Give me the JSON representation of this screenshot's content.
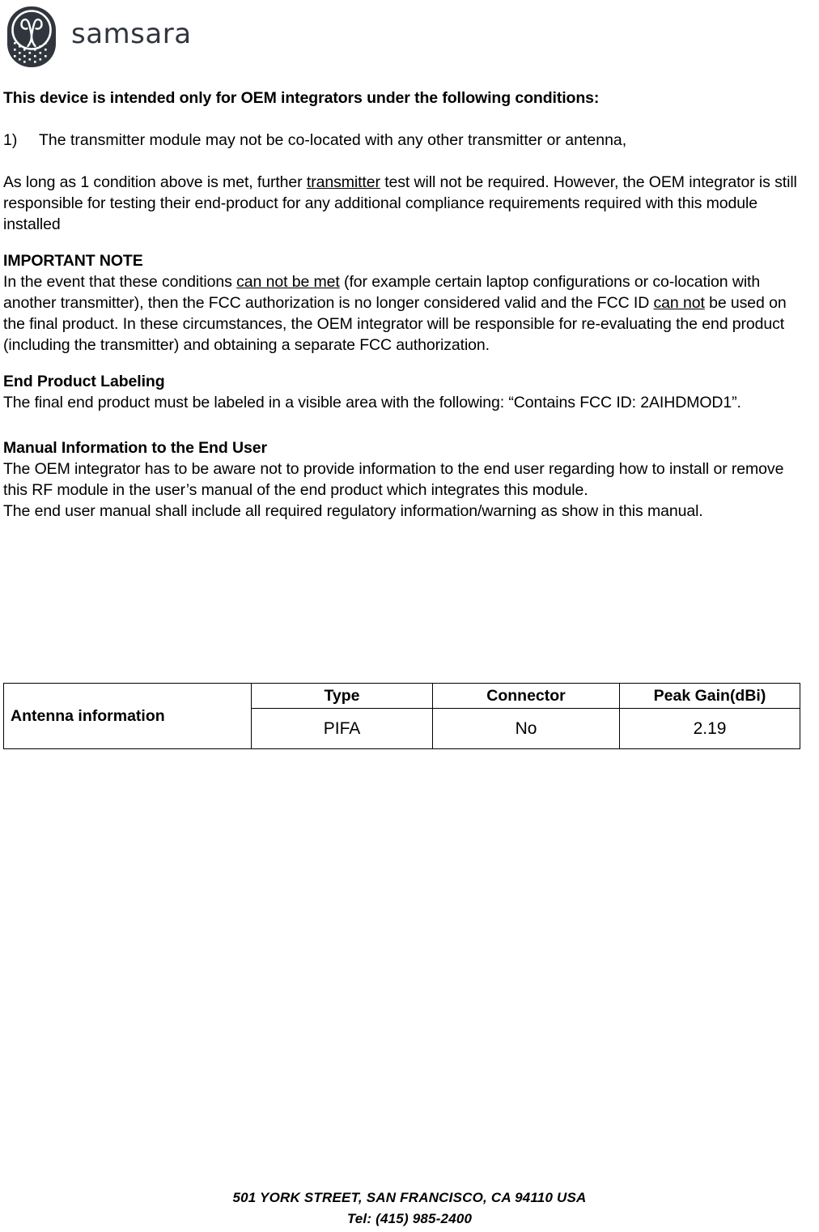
{
  "brand": {
    "logo_icon": "samsara-owl-logo-icon",
    "wordmark": "samsara",
    "logo_color": "#31363e"
  },
  "document": {
    "heading": "This device is intended only for OEM integrators under the following conditions:",
    "condition": {
      "number": "1)",
      "text": "The transmitter module may not be co-located with any other transmitter or antenna,"
    },
    "paragraph_1": {
      "lead": "As long as 1 condition above is met, further ",
      "underlined": "transmitter",
      "rest": " test will not be required. However, the OEM integrator is still responsible for testing their end-product for any additional compliance requirements required with this module installed"
    },
    "important_note": {
      "title": "IMPORTANT NOTE",
      "part_1": "In the event that these conditions ",
      "underlined_1": "can not be met",
      "part_2": " (for example certain laptop configurations or co-location with another transmitter), then the FCC authorization is no longer considered valid and the FCC ID ",
      "underlined_2": "can not",
      "part_3": " be used on the final product. In these circumstances, the OEM integrator will be responsible for re-evaluating the end product (including the transmitter) and obtaining a separate FCC authorization."
    },
    "end_product_labeling": {
      "title": "End Product Labeling",
      "body": "The final end product must be labeled in a visible area with the following: “Contains FCC ID: 2AIHDMOD1”."
    },
    "manual_information": {
      "title": "Manual Information to the End User",
      "body_1": "The OEM integrator has to be aware not to provide information to the end user regarding how to install or remove this RF module in the user’s manual of the end product which integrates this module.",
      "body_2": "The end user manual shall include all required regulatory information/warning as show in this manual."
    }
  },
  "antenna_table": {
    "row_label": "Antenna information",
    "headers": [
      "Type",
      "Connector",
      "Peak Gain(dBi)"
    ],
    "values": [
      "PIFA",
      "No",
      "2.19"
    ]
  },
  "footer": {
    "address": "501 YORK STREET, SAN FRANCISCO, CA 94110 USA",
    "phone": "Tel: (415) 985-2400"
  }
}
